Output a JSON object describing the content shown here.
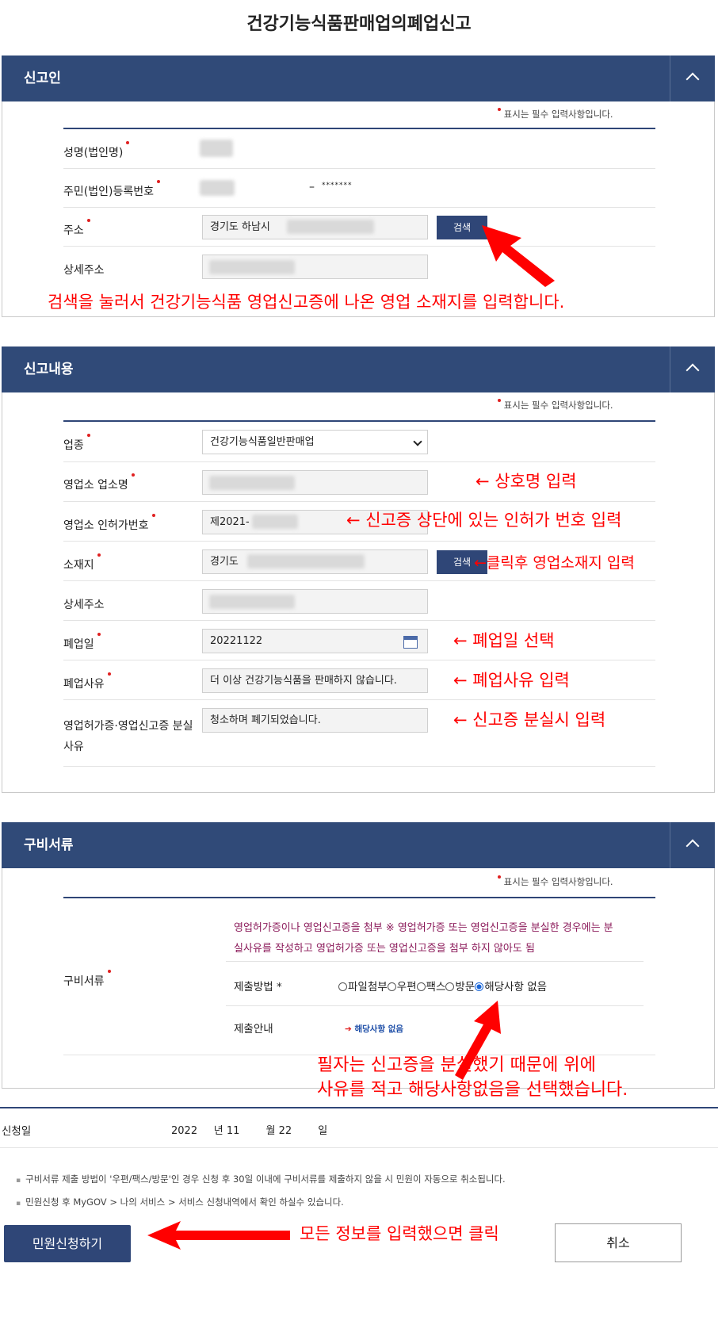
{
  "page_title": "건강기능식품판매업의폐업신고",
  "required_note": "표시는 필수 입력사항입니다.",
  "sections": {
    "applicant": {
      "title": "신고인",
      "fields": {
        "name_label": "성명(법인명)",
        "rrn_label": "주민(법인)등록번호",
        "rrn_masked": "*******",
        "address_label": "주소",
        "address_value": "경기도 하남시",
        "detail_label": "상세주소"
      },
      "search_button": "검색",
      "annotation": "검색을 눌러서 건강기능식품 영업신고증에 나온 영업 소재지를 입력합니다."
    },
    "report": {
      "title": "신고내용",
      "fields": {
        "industry_label": "업종",
        "industry_value": "건강기능식품일반판매업",
        "biz_name_label": "영업소 업소명",
        "license_label": "영업소 인허가번호",
        "license_value": "제2021-",
        "location_label": "소재지",
        "location_value": "경기도",
        "detail_label": "상세주소",
        "closing_date_label": "폐업일",
        "closing_date_value": "20221122",
        "reason_label": "폐업사유",
        "reason_value": "더 이상 건강기능식품을 판매하지 않습니다.",
        "loss_label": "영업허가증·영업신고증 분실사유",
        "loss_value": "청소하며 폐기되었습니다."
      },
      "search_button": "검색",
      "annotations": {
        "biz_name": "← 상호명 입력",
        "license": "← 신고증 상단에 있는 인허가 번호 입력",
        "location": "←클릭후 영업소재지 입력",
        "closing_date": "← 폐업일 선택",
        "reason": "← 폐업사유 입력",
        "loss": "← 신고증 분실시 입력"
      }
    },
    "documents": {
      "title": "구비서류",
      "label": "구비서류",
      "description": "영업허가증이나 영업신고증을 첨부 ※ 영업허가증 또는 영업신고증을 분실한 경우에는 분실사유를 작성하고 영업허가증 또는 영업신고증을 첨부 하지 않아도 됨",
      "method_label": "제출방법 *",
      "methods": [
        "파일첨부",
        "우편",
        "팩스",
        "방문",
        "해당사항 없음"
      ],
      "selected_method": "해당사항 없음",
      "guide_label": "제출안내",
      "guide_value": "해당사항 없음",
      "annotation_line1": "필자는 신고증을 분실했기 때문에 위에",
      "annotation_line2": "사유를 적고 해당사항없음을 선택했습니다."
    }
  },
  "application_date": {
    "label": "신청일",
    "year": "2022",
    "year_unit": "년",
    "month": "11",
    "month_unit": "월",
    "day": "22",
    "day_unit": "일"
  },
  "notes": [
    "구비서류 제출 방법이 '우편/팩스/방문'인 경우 신청 후 30일 이내에 구비서류를 제출하지 않을 시 민원이 자동으로 취소됩니다.",
    "민원신청 후 MyGOV > 나의 서비스 > 서비스 신청내역에서 확인 하실수 있습니다."
  ],
  "buttons": {
    "submit": "민원신청하기",
    "cancel": "취소"
  },
  "final_annotation": "모든 정보를 입력했으면 클릭",
  "colors": {
    "header_bg": "#304a78",
    "annotation": "#ff0000",
    "required_dot": "#e02020",
    "doc_description": "#8b1a5a"
  }
}
